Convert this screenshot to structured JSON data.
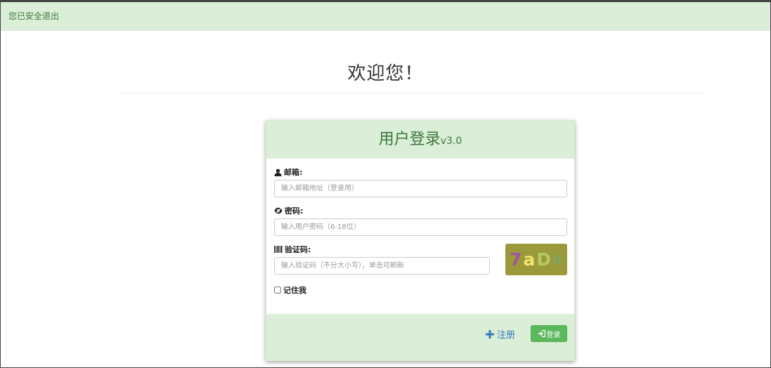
{
  "alert": {
    "text": "您已安全退出"
  },
  "welcome": {
    "title": "欢迎您！"
  },
  "login": {
    "title": "用户登录",
    "version": "v3.0",
    "email_label": "邮箱:",
    "email_placeholder": "输入邮箱地址（登录用）",
    "password_label": "密码:",
    "password_placeholder": "输入用户密码（6-18位）",
    "captcha_label": "验证码:",
    "captcha_placeholder": "输入验证码（不分大小写），单击可刷新",
    "captcha_chars": [
      "7",
      "a",
      "D",
      "b"
    ],
    "remember_label": "记住我",
    "register_label": "注册",
    "login_label": "登录"
  },
  "colors": {
    "alert_bg": "#dbeed8",
    "alert_text": "#3c763d",
    "link": "#337ab7",
    "success": "#5cb85c"
  },
  "icons": {
    "email": "user-icon",
    "password": "eye-icon",
    "captcha": "barcode-icon",
    "register": "plus-icon",
    "login": "log-in-icon"
  }
}
